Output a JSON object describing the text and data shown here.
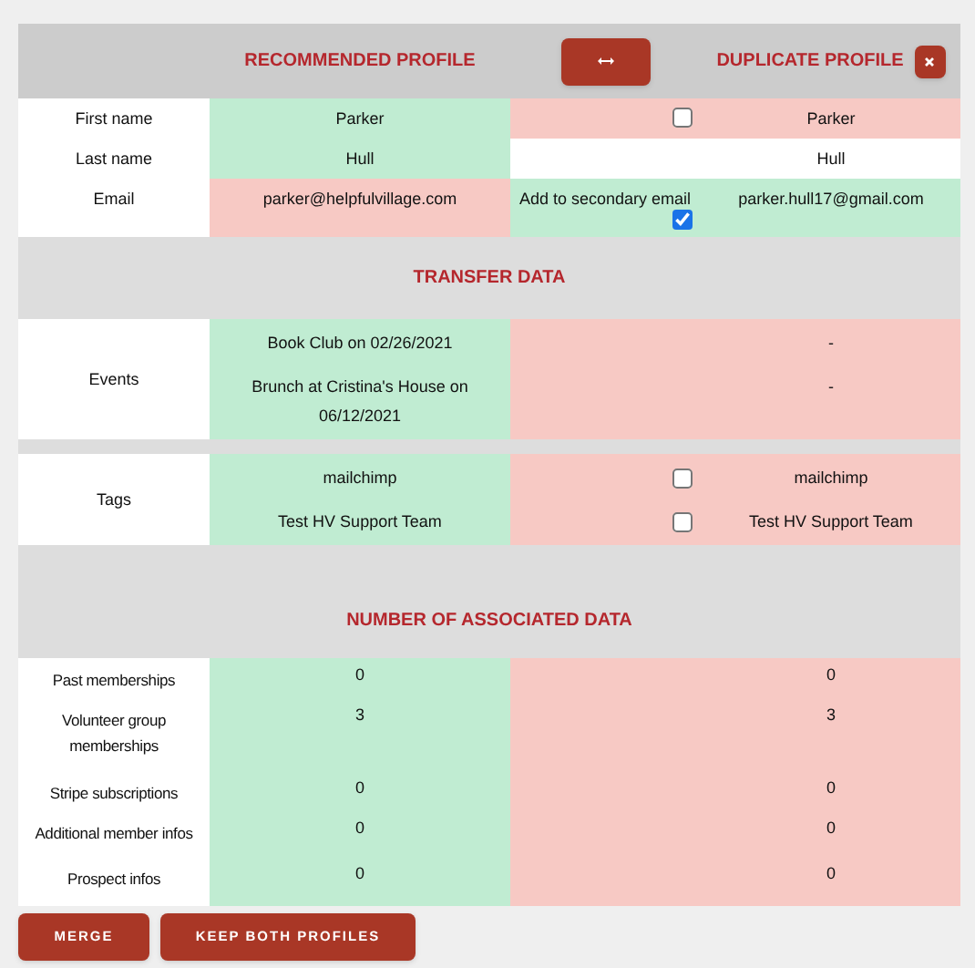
{
  "header": {
    "recommended_title": "RECOMMENDED PROFILE",
    "duplicate_title": "DUPLICATE PROFILE"
  },
  "fields": [
    {
      "label": "First name",
      "recommended": {
        "text": "Parker",
        "color": "#c0ecd2"
      },
      "duplicate": {
        "text": "Parker",
        "color": "#f7c9c4"
      },
      "checkbox": {
        "checked": false
      }
    },
    {
      "label": "Last name",
      "recommended": {
        "text": "Hull",
        "color": "#c0ecd2"
      },
      "duplicate": {
        "text": "Hull",
        "color": "#ffffff"
      }
    },
    {
      "label": "Email",
      "recommended": {
        "text": "parker@helpfulvillage.com",
        "color": "#f7c9c4"
      },
      "duplicate": {
        "text": "parker.hull17@gmail.com",
        "color": "#c0ecd2"
      },
      "checkbox": {
        "label": "Add to secondary email",
        "checked": true
      }
    }
  ],
  "transfer": {
    "title": "TRANSFER DATA",
    "events": {
      "label": "Events",
      "items": [
        {
          "recommended": "Book Club on 02/26/2021",
          "duplicate": "-"
        },
        {
          "recommended": "Brunch at Cristina's House on 06/12/2021",
          "duplicate": "-"
        }
      ]
    },
    "tags": {
      "label": "Tags",
      "items": [
        {
          "recommended": "mailchimp",
          "duplicate": "mailchimp",
          "checked": false
        },
        {
          "recommended": "Test HV Support Team",
          "duplicate": "Test HV Support Team",
          "checked": false
        }
      ]
    }
  },
  "associated": {
    "title": "NUMBER OF ASSOCIATED DATA",
    "rows": [
      {
        "label": "Past memberships",
        "recommended": "0",
        "duplicate": "0"
      },
      {
        "label": "Volunteer group memberships",
        "recommended": "3",
        "duplicate": "3"
      },
      {
        "label": "Stripe subscriptions",
        "recommended": "0",
        "duplicate": "0"
      },
      {
        "label": "Additional member infos",
        "recommended": "0",
        "duplicate": "0"
      },
      {
        "label": "Prospect infos",
        "recommended": "0",
        "duplicate": "0"
      }
    ]
  },
  "buttons": [
    "MERGE",
    "KEEP BOTH PROFILES"
  ]
}
